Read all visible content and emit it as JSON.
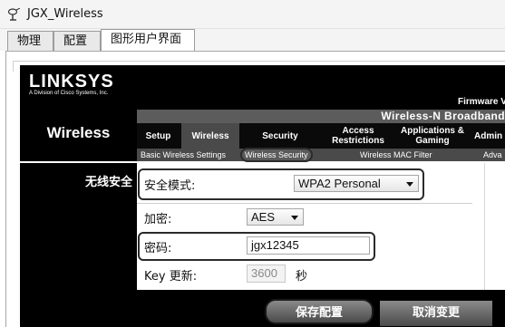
{
  "window": {
    "title": "JGX_Wireless"
  },
  "tabs": [
    {
      "label": "物理",
      "active": false
    },
    {
      "label": "配置",
      "active": false
    },
    {
      "label": "图形用户界面",
      "active": true
    }
  ],
  "header": {
    "logo": "LINKSYS",
    "logo_sub": "A Division of Cisco Systems, Inc.",
    "firmware": "Firmware V"
  },
  "nav": {
    "section_title": "Wireless",
    "product": "Wireless-N Broadband",
    "menu": [
      {
        "label": "Setup",
        "active": false
      },
      {
        "label": "Wireless",
        "active": true
      },
      {
        "label": "Security",
        "active": false
      },
      {
        "label": "Access Restrictions",
        "active": false
      },
      {
        "label": "Applications & Gaming",
        "active": false
      },
      {
        "label": "Admin",
        "active": false
      }
    ],
    "submenu": [
      {
        "label": "Basic Wireless Settings",
        "active": false
      },
      {
        "label": "Wireless Security",
        "active": true
      },
      {
        "label": "Wireless MAC Filter",
        "active": false
      },
      {
        "label": "Adva",
        "active": false
      }
    ]
  },
  "content": {
    "section_label": "无线安全",
    "security_mode": {
      "label": "安全模式:",
      "value": "WPA2 Personal"
    },
    "encryption": {
      "label": "加密:",
      "value": "AES"
    },
    "passphrase": {
      "label": "密码:",
      "value": "jgx12345"
    },
    "key_renewal": {
      "label": "Key 更新:",
      "value": "3600",
      "unit": "秒"
    }
  },
  "buttons": {
    "save": "保存配置",
    "cancel": "取消变更"
  },
  "colors": {
    "header_bg": "#000000",
    "nav_active": "#4a4a4a",
    "highlight_outline": "#2b2b2b"
  }
}
